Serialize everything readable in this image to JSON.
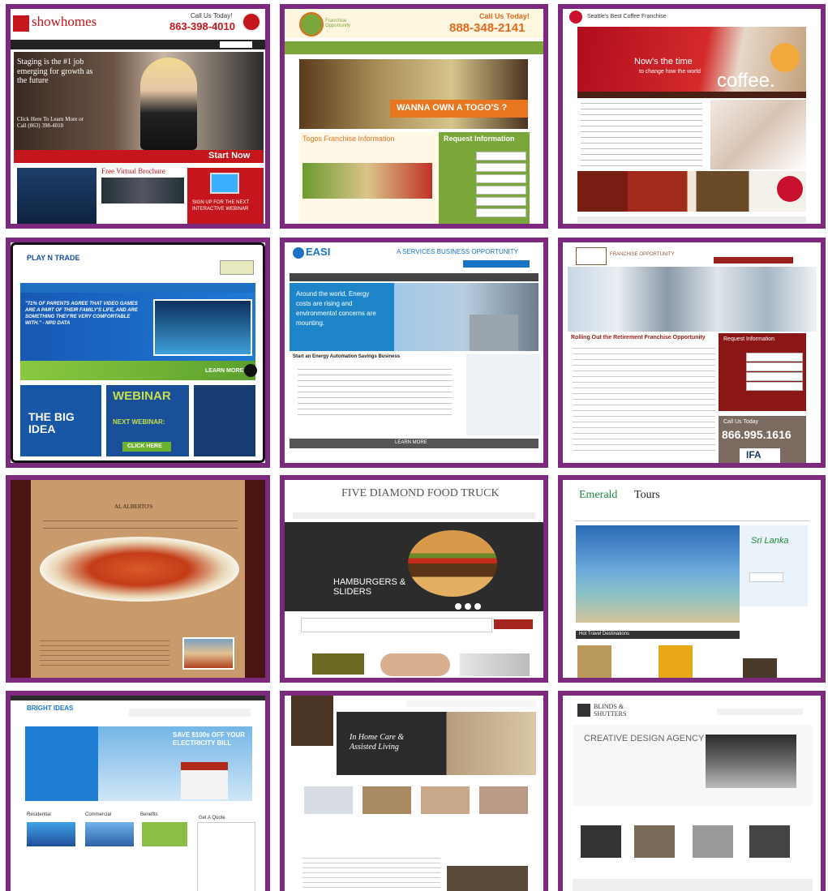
{
  "colors": {
    "frame": "#7b2a7d"
  },
  "tiles": {
    "t1": {
      "brand": "showhomes",
      "phone_label": "Call Us Today!",
      "phone": "863-398-4010",
      "hero": "Staging is the #1 job emerging for growth as the future",
      "cta": "Click Here To Learn More or Call (863) 398-4010",
      "start": "Start Now",
      "brochure": "Free Virtual Brochure",
      "webinar": "SIGN UP FOR THE NEXT INTERACTIVE WEBINAR"
    },
    "t2": {
      "brand": "Franchise Opportunity",
      "call": "Call Us Today!",
      "phone": "888-348-2141",
      "banner": "WANNA OWN A TOGO'S ?",
      "info_title": "Togos Franchise Information",
      "request": "Request Information"
    },
    "t3": {
      "brand": "Seattle's Best Coffee Franchise",
      "hero_line1": "Now's the time",
      "hero_line2": "to change how the world",
      "hero_word": "coffee."
    },
    "t4": {
      "brand": "PLAY N TRADE",
      "quote": "\"71% OF PARENTS AGREE THAT VIDEO GAMES ARE A PART OF THEIR FAMILY'S LIFE, AND ARE SOMETHING THEY'RE VERY COMFORTABLE WITH.\" - NPD DATA",
      "learn": "LEARN MORE",
      "big": "THE BIG IDEA",
      "webinar": "WEBINAR",
      "next": "NEXT WEBINAR:",
      "click": "CLICK HERE"
    },
    "t5": {
      "brand": "EASI",
      "tagline": "A SERVICES BUSINESS OPPORTUNITY",
      "hero": "Around the world, Energy costs are rising and environmental concerns are mounting.",
      "heading": "Start an Energy Automation Savings Business",
      "learn": "LEARN MORE"
    },
    "t6": {
      "brand": "FRANCHISE OPPORTUNITY",
      "heading": "Rolling Out the Retirement Franchise Opportunity",
      "request": "Request Information",
      "call": "Call Us Today",
      "phone": "866.995.1616",
      "ifa": "IFA"
    },
    "t7": {
      "brand": "AL ALBERTO'S"
    },
    "t8": {
      "title": "FIVE DIAMOND FOOD TRUCK",
      "hero": "HAMBURGERS & SLIDERS"
    },
    "t9": {
      "brand_a": "Emerald",
      "brand_b": "Tours",
      "hero": "Sri Lanka",
      "section": "Hot Travel Destinations"
    },
    "t10": {
      "brand": "BRIGHT IDEAS",
      "hero_right": "SAVE $100s OFF YOUR ELECTRICITY BILL",
      "col1": "Residential",
      "col2": "Commercial",
      "col3": "Benefits",
      "col4": "Get A Quote"
    },
    "t11": {
      "hero": "In Home Care & Assisted Living"
    },
    "t12": {
      "brand": "BLINDS & SHUTTERS",
      "hero": "CREATIVE DESIGN AGENCY"
    }
  }
}
